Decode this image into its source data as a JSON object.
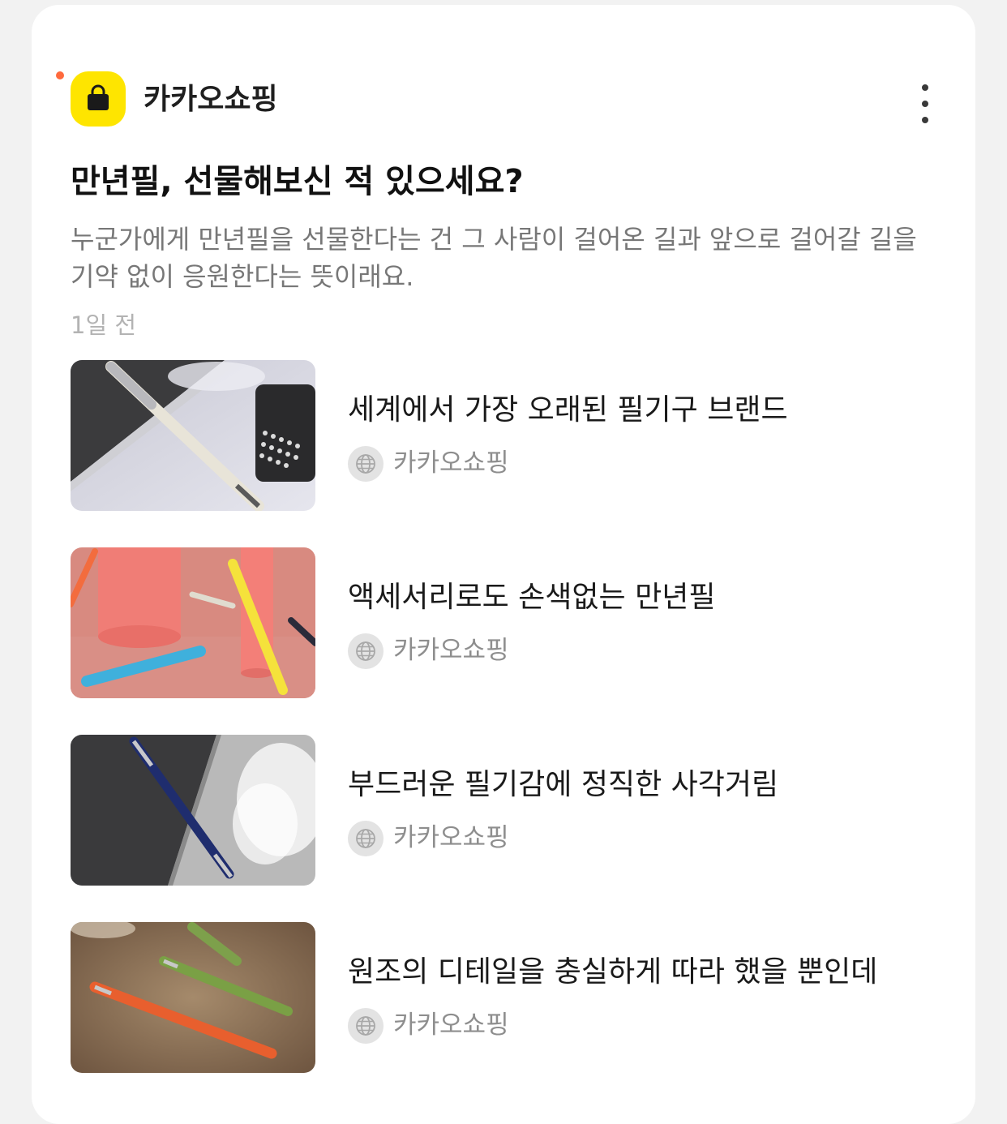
{
  "channel": {
    "name": "카카오쇼핑",
    "logo_icon": "shopping-bag-icon",
    "logo_color": "#fee500",
    "unread_dot_color": "#ff6a3d"
  },
  "post": {
    "title": "만년필, 선물해보신 적 있으세요?",
    "description": "누군가에게 만년필을 선물한다는 건 그 사람이 걸어온 길과 앞으로 걸어갈 길을 기약 없이 응원한다는 뜻이래요.",
    "time": "1일 전"
  },
  "articles": [
    {
      "title": "세계에서 가장 오래된 필기구 브랜드",
      "source": "카카오쇼핑",
      "source_icon": "globe-icon",
      "thumbnail": "white-pen-and-typewriter"
    },
    {
      "title": "액세서리로도 손색없는 만년필",
      "source": "카카오쇼핑",
      "source_icon": "globe-icon",
      "thumbnail": "colorful-pens-on-pink"
    },
    {
      "title": "부드러운 필기감에 정직한 사각거림",
      "source": "카카오쇼핑",
      "source_icon": "globe-icon",
      "thumbnail": "navy-pen-on-notebook"
    },
    {
      "title": "원조의 디테일을 충실하게 따라 했을 뿐인데",
      "source": "카카오쇼핑",
      "source_icon": "globe-icon",
      "thumbnail": "orange-and-green-pens"
    }
  ],
  "more_icon": "more-vertical-icon"
}
